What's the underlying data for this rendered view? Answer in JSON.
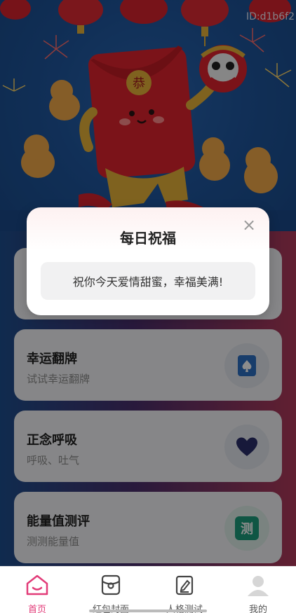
{
  "banner": {
    "id_label": "ID:d1b6f2",
    "envelope_char": "恭"
  },
  "cards": [
    {
      "title": "",
      "subtitle": "",
      "icon": "hidden"
    },
    {
      "title": "幸运翻牌",
      "subtitle": "试试幸运翻牌",
      "icon": "spade-card-icon"
    },
    {
      "title": "正念呼吸",
      "subtitle": "呼吸、吐气",
      "icon": "heart-icon"
    },
    {
      "title": "能量值测评",
      "subtitle": "测测能量值",
      "icon_text": "测",
      "icon": "test-badge-icon"
    }
  ],
  "modal": {
    "title": "每日祝福",
    "message": "祝你今天爱情甜蜜，幸福美满!",
    "close_glyph": "×"
  },
  "tabbar": {
    "items": [
      {
        "label": "首页",
        "icon": "home-icon",
        "active": true
      },
      {
        "label": "红包封面",
        "icon": "red-packet-icon",
        "active": false
      },
      {
        "label": "人格测试",
        "icon": "test-edit-icon",
        "active": false
      },
      {
        "label": "我的",
        "icon": "profile-icon",
        "active": false
      }
    ]
  },
  "colors": {
    "accent": "#e23b78",
    "red": "#d9242f",
    "gold": "#e8b23a",
    "blue_bg": "#1f579f"
  }
}
